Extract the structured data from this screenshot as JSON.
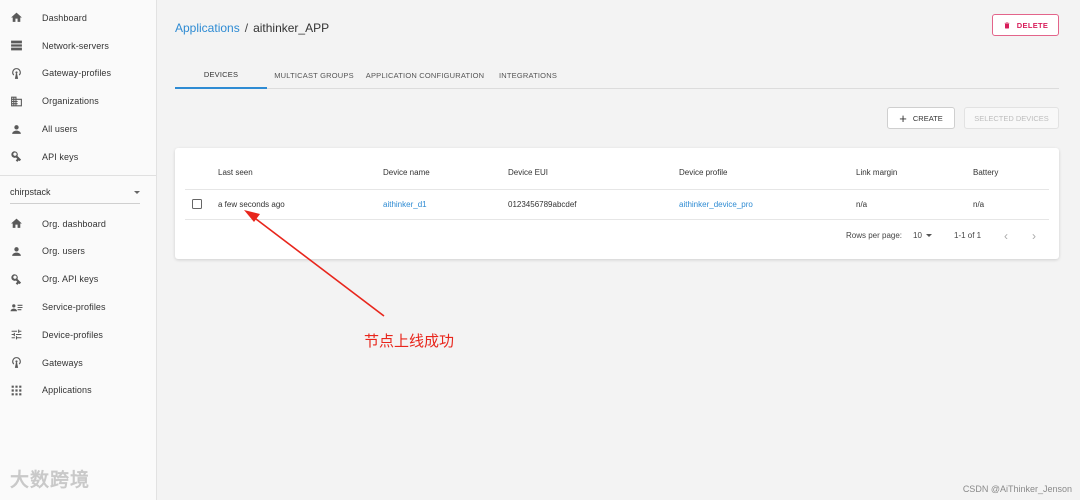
{
  "sidebar": {
    "top_items": [
      {
        "label": "Dashboard",
        "icon": "home-icon"
      },
      {
        "label": "Network-servers",
        "icon": "server-icon"
      },
      {
        "label": "Gateway-profiles",
        "icon": "radio-tower-icon"
      },
      {
        "label": "Organizations",
        "icon": "domain-icon"
      },
      {
        "label": "All users",
        "icon": "user-icon"
      },
      {
        "label": "API keys",
        "icon": "key-icon"
      }
    ],
    "org_select": "chirpstack",
    "org_items": [
      {
        "label": "Org. dashboard",
        "icon": "home-icon"
      },
      {
        "label": "Org. users",
        "icon": "user-icon"
      },
      {
        "label": "Org. API keys",
        "icon": "key-icon"
      },
      {
        "label": "Service-profiles",
        "icon": "account-details-icon"
      },
      {
        "label": "Device-profiles",
        "icon": "tune-icon"
      },
      {
        "label": "Gateways",
        "icon": "radio-tower-icon"
      },
      {
        "label": "Applications",
        "icon": "apps-grid-icon"
      }
    ]
  },
  "header": {
    "breadcrumb_link": "Applications",
    "breadcrumb_sep": "/",
    "breadcrumb_current": "aithinker_APP",
    "delete_label": "DELETE"
  },
  "tabs": [
    "DEVICES",
    "MULTICAST GROUPS",
    "APPLICATION CONFIGURATION",
    "INTEGRATIONS"
  ],
  "actions": {
    "create_label": "CREATE",
    "selected_devices_label": "SELECTED DEVICES"
  },
  "table": {
    "headers": [
      "Last seen",
      "Device name",
      "Device EUI",
      "Device profile",
      "Link margin",
      "Battery"
    ],
    "rows": [
      {
        "last_seen": "a few seconds ago",
        "device_name": "aithinker_d1",
        "device_eui": "0123456789abcdef",
        "device_profile": "aithinker_device_pro",
        "link_margin": "n/a",
        "battery": "n/a"
      }
    ],
    "rows_per_page_label": "Rows per page:",
    "rows_per_page_value": "10",
    "page_range": "1-1 of 1"
  },
  "annotation": {
    "text": "节点上线成功",
    "color": "#e8261c"
  },
  "watermarks": {
    "left": "大数跨境",
    "right": "CSDN @AiThinker_Jenson"
  },
  "colors": {
    "accent": "#2e8bd3",
    "danger": "#d81e5b"
  }
}
